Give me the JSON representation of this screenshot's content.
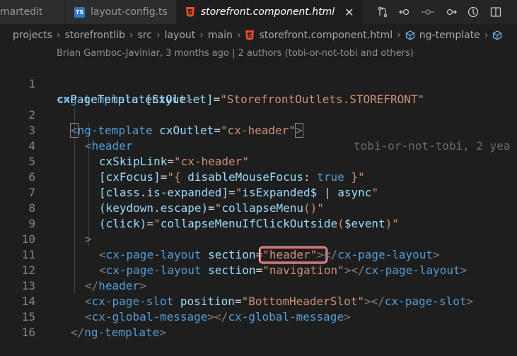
{
  "tabs": [
    {
      "label": "martedit",
      "icon": null,
      "active": false
    },
    {
      "label": "layout-config.ts",
      "icon": "ts-icon",
      "active": false
    },
    {
      "label": "storefront.component.html",
      "icon": "html-icon",
      "active": true
    }
  ],
  "tab_actions": [
    "compare-changes-icon",
    "go-back-icon",
    "git-commit-icon",
    "go-forward-icon",
    "open-timeline-icon",
    "split-editor-icon"
  ],
  "breadcrumb": [
    "projects",
    "storefrontlib",
    "src",
    "layout",
    "main",
    "storefront.component.html",
    "ng-template"
  ],
  "blame_header": "Brian Gamboc-Javiniar, 3 months ago | 2 authors (tobi-or-not-tobi and others)",
  "inline_blame": "tobi-or-not-tobi, 2 yea",
  "code": {
    "l1a": "<ng-template",
    "l1b": "[cxOutlet]",
    "l1c": "\"StorefrontOutlets.STOREFRONT\"",
    "l1d": "cxPageTemplateStyle",
    "l2a": "ng-template",
    "l2b": "cxOutlet",
    "l2c": "\"cx-header\"",
    "l3": "header",
    "l4a": "cxSkipLink",
    "l4b": "\"cx-header\"",
    "l5a": "[cxFocus]",
    "l5b": "\"{ ",
    "l5c": "disableMouseFocus",
    "l5d": ": ",
    "l5e": "true",
    "l5f": " }\"",
    "l6a": "[class.is-expanded]",
    "l6b": "\"",
    "l6c": "isExpanded$",
    "l6d": " | ",
    "l6e": "async",
    "l6f": "\"",
    "l7a": "(keydown.escape)",
    "l7b": "\"",
    "l7c": "collapseMenu",
    "l7d": "()\"",
    "l8a": "(click)",
    "l8b": "\"",
    "l8c": "collapseMenuIfClickOutside",
    "l8d": "(",
    "l8e": "$event",
    "l8f": ")\"",
    "l9": ">",
    "l10a": "cx-page-layout",
    "l10b": "section",
    "l10c": "\"header\"",
    "l10d": "cx-page-layout",
    "l11a": "cx-page-layout",
    "l11b": "section",
    "l11c": "\"navigation\"",
    "l11d": "cx-page-layout",
    "l12": "header",
    "l13a": "cx-page-slot",
    "l13b": "position",
    "l13c": "\"BottomHeaderSlot\"",
    "l13d": "cx-page-slot",
    "l14a": "cx-global-message",
    "l14b": "cx-global-message",
    "l15": "ng-template"
  },
  "line_numbers": [
    "1",
    "2",
    "3",
    "4",
    "5",
    "6",
    "7",
    "8",
    "9",
    "10",
    "11",
    "12",
    "13",
    "14",
    "15",
    "16"
  ]
}
